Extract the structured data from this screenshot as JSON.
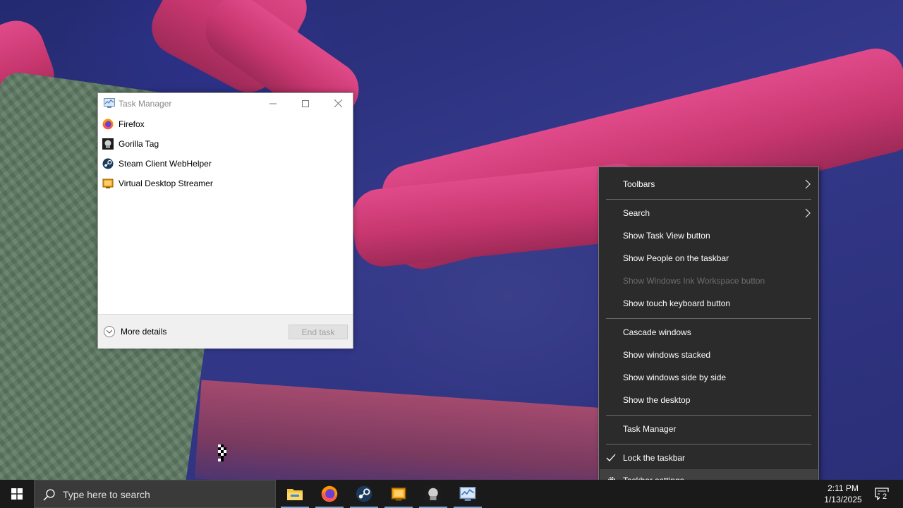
{
  "task_manager": {
    "title": "Task Manager",
    "processes": [
      {
        "name": "Firefox",
        "icon": "firefox-icon"
      },
      {
        "name": "Gorilla Tag",
        "icon": "gorilla-tag-icon"
      },
      {
        "name": "Steam Client WebHelper",
        "icon": "steam-icon"
      },
      {
        "name": "Virtual Desktop Streamer",
        "icon": "virtual-desktop-icon"
      }
    ],
    "more_details": "More details",
    "end_task": "End task"
  },
  "context_menu": {
    "items": [
      {
        "label": "Toolbars",
        "submenu": true
      },
      {
        "label": "Search",
        "submenu": true
      },
      {
        "label": "Show Task View button"
      },
      {
        "label": "Show People on the taskbar"
      },
      {
        "label": "Show Windows Ink Workspace button",
        "disabled": true
      },
      {
        "label": "Show touch keyboard button"
      },
      {
        "label": "Cascade windows"
      },
      {
        "label": "Show windows stacked"
      },
      {
        "label": "Show windows side by side"
      },
      {
        "label": "Show the desktop"
      },
      {
        "label": "Task Manager"
      },
      {
        "label": "Lock the taskbar",
        "checked": true
      },
      {
        "label": "Taskbar settings",
        "icon": "gear-icon",
        "highlighted": true
      }
    ]
  },
  "taskbar": {
    "search_placeholder": "Type here to search",
    "apps": [
      "file-explorer-icon",
      "firefox-icon",
      "steam-icon",
      "virtual-desktop-icon",
      "gorilla-tag-icon",
      "task-manager-icon"
    ],
    "time": "2:11 PM",
    "date": "1/13/2025",
    "notification_count": "2"
  },
  "colors": {
    "menu_bg": "#2b2b2b",
    "taskbar_bg": "#1a1a1a",
    "accent_underline": "#7aa7d6"
  }
}
